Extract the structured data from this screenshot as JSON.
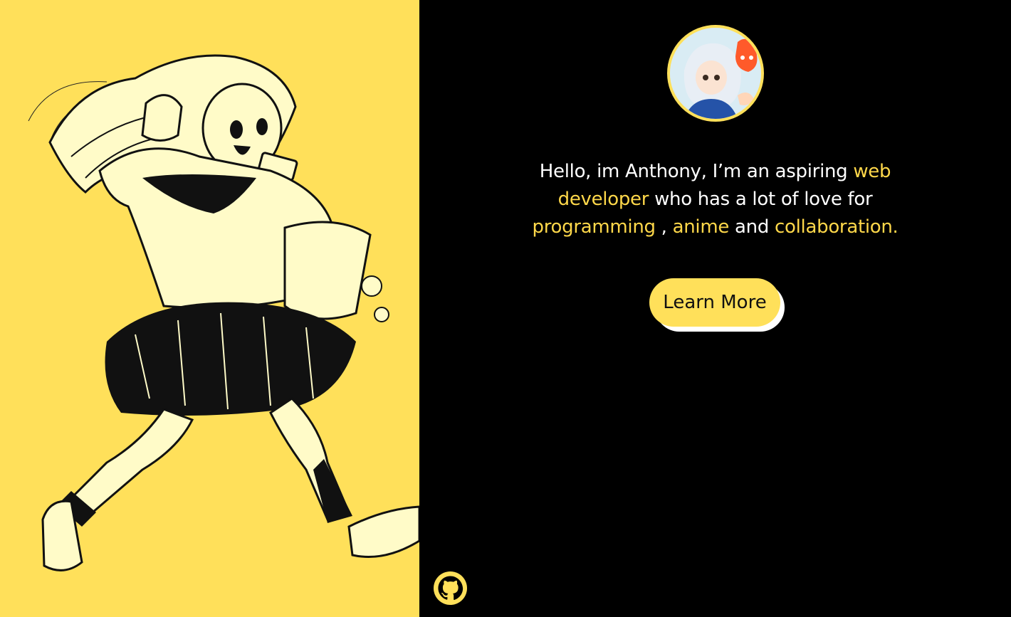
{
  "intro": {
    "part1": "Hello, im Anthony, I’m an aspiring ",
    "highlight1": "web developer",
    "part2": " who has a lot of love for ",
    "highlight2": "programming",
    "part3": " , ",
    "highlight3": "anime",
    "part4": " and ",
    "highlight4": "collaboration."
  },
  "cta": {
    "label": "Learn More"
  },
  "icons": {
    "social": "github-icon"
  },
  "colors": {
    "accent": "#FFE05A",
    "highlight_text": "#FFD84A",
    "background": "#000000",
    "text": "#FFFFFF"
  }
}
